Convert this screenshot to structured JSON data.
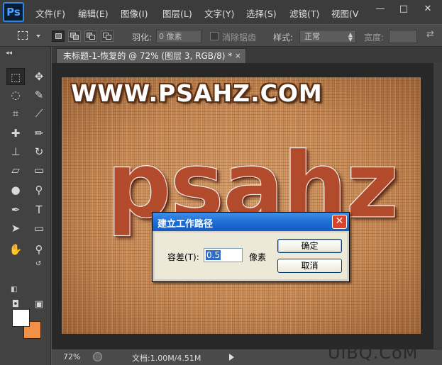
{
  "app": {
    "logo": "Ps"
  },
  "menu": [
    "文件(F)",
    "编辑(E)",
    "图像(I)",
    "图层(L)",
    "文字(Y)",
    "选择(S)",
    "滤镜(T)",
    "视图(V"
  ],
  "window_controls": {
    "minimize": "—",
    "maximize": "□",
    "close": "✕"
  },
  "options_bar": {
    "feather_label": "羽化:",
    "feather_value": "0 像素",
    "antialias_label": "消除锯齿",
    "style_label": "样式:",
    "style_value": "正常",
    "width_label": "宽度:"
  },
  "tools": {
    "icons": [
      "marquee-icon",
      "move-icon",
      "lasso-icon",
      "quick-select-icon",
      "crop-icon",
      "eyedropper-icon",
      "healing-brush-icon",
      "brush-icon",
      "clone-stamp-icon",
      "history-brush-icon",
      "eraser-icon",
      "gradient-icon",
      "blur-icon",
      "dodge-icon",
      "pen-icon",
      "type-icon",
      "path-select-icon",
      "rectangle-icon",
      "hand-icon",
      "zoom-icon"
    ],
    "foreground_color": "#ffffff",
    "background_color": "#f0914a"
  },
  "document": {
    "tab_title": "未标题-1-恢复的 @ 72% (图层 3, RGB/8) *",
    "tab_close": "×",
    "canvas_title_text": "WWW.PSAHZ.COM",
    "canvas_big_text": "psahz"
  },
  "status_bar": {
    "zoom": "72%",
    "doc_info": "文档:1.00M/4.51M"
  },
  "watermark": "UiBQ.CoM",
  "dialog": {
    "title": "建立工作路径",
    "close": "✕",
    "tolerance_label": "容差(T):",
    "tolerance_value": "0.5",
    "unit": "像素",
    "ok_label": "确定",
    "cancel_label": "取消"
  }
}
